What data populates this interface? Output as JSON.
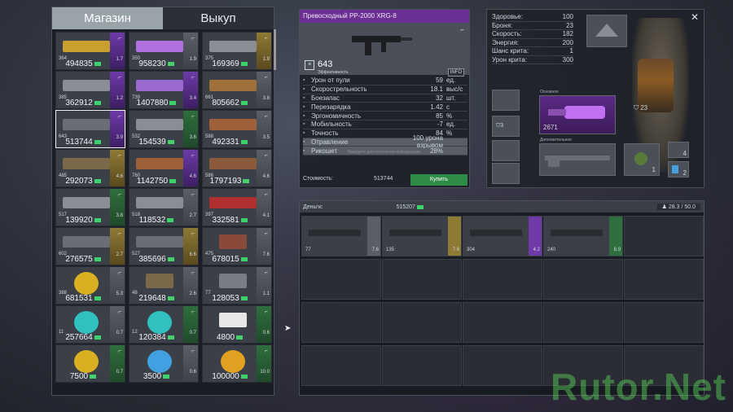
{
  "shop": {
    "tabs": [
      "Магазин",
      "Выкуп"
    ],
    "items": [
      {
        "price": "494835",
        "level": "364",
        "rating": "1.7",
        "tier": "purple",
        "color": "#c9a030",
        "kind": "gun"
      },
      {
        "price": "958230",
        "level": "350",
        "rating": "1.9",
        "tier": "gray",
        "color": "#b070e0",
        "kind": "gun"
      },
      {
        "price": "169369",
        "level": "375",
        "rating": "1.9",
        "tier": "gold",
        "color": "#8a8e94",
        "kind": "gun"
      },
      {
        "price": "362912",
        "level": "385",
        "rating": "1.2",
        "tier": "purple",
        "color": "#8a8e94",
        "kind": "gun"
      },
      {
        "price": "1407880",
        "level": "739",
        "rating": "3.4",
        "tier": "purple",
        "color": "#9a6ad0",
        "kind": "gun"
      },
      {
        "price": "805662",
        "level": "661",
        "rating": "3.8",
        "tier": "gray",
        "color": "#a0703a",
        "kind": "gun"
      },
      {
        "price": "513744",
        "level": "643",
        "rating": "3.9",
        "tier": "purple",
        "color": "#6a6e74",
        "kind": "gun",
        "selected": true
      },
      {
        "price": "154539",
        "level": "532",
        "rating": "3.6",
        "tier": "green",
        "color": "#8a8e94",
        "kind": "gun"
      },
      {
        "price": "492331",
        "level": "588",
        "rating": "3.5",
        "tier": "gray",
        "color": "#a0603a",
        "kind": "gun"
      },
      {
        "price": "292073",
        "level": "485",
        "rating": "4.6",
        "tier": "gold",
        "color": "#7a6a4a",
        "kind": "gun"
      },
      {
        "price": "1142750",
        "level": "760",
        "rating": "4.6",
        "tier": "purple",
        "color": "#a0603a",
        "kind": "gun"
      },
      {
        "price": "1797193",
        "level": "586",
        "rating": "4.6",
        "tier": "gray",
        "color": "#8a5a3a",
        "kind": "gun"
      },
      {
        "price": "139920",
        "level": "517",
        "rating": "3.8",
        "tier": "green",
        "color": "#8a8e94",
        "kind": "gun"
      },
      {
        "price": "118532",
        "level": "518",
        "rating": "2.7",
        "tier": "gray",
        "color": "#8a8e94",
        "kind": "gun"
      },
      {
        "price": "332581",
        "level": "397",
        "rating": "4.1",
        "tier": "gray",
        "color": "#b03030",
        "kind": "gun"
      },
      {
        "price": "276575",
        "level": "602",
        "rating": "2.7",
        "tier": "gold",
        "color": "#6a6e74",
        "kind": "gun"
      },
      {
        "price": "385696",
        "level": "527",
        "rating": "6.6",
        "tier": "gold",
        "color": "#6a6e74",
        "kind": "gun"
      },
      {
        "price": "678015",
        "level": "475",
        "rating": "7.6",
        "tier": "gray",
        "color": "#8a4a3a",
        "kind": "armor"
      },
      {
        "price": "681531",
        "level": "388",
        "rating": "5.3",
        "tier": "gray",
        "color": "#d8b020",
        "kind": "round"
      },
      {
        "price": "219648",
        "level": "48",
        "rating": "2.6",
        "tier": "gray",
        "color": "#7a6a4a",
        "kind": "armor"
      },
      {
        "price": "128053",
        "level": "77",
        "rating": "1.1",
        "tier": "gray",
        "color": "#7a7e84",
        "kind": "armor"
      },
      {
        "price": "257664",
        "level": "11",
        "rating": "0.7",
        "tier": "gray",
        "color": "#30c0c0",
        "kind": "round"
      },
      {
        "price": "120384",
        "level": "12",
        "rating": "0.7",
        "tier": "green",
        "color": "#30c0c0",
        "kind": "round"
      },
      {
        "price": "4800",
        "level": "",
        "rating": "0.6",
        "tier": "green",
        "color": "#e8e8e8",
        "kind": "kit"
      },
      {
        "price": "7500",
        "level": "",
        "rating": "0.7",
        "tier": "green",
        "color": "#d8b020",
        "kind": "round"
      },
      {
        "price": "3500",
        "level": "",
        "rating": "0.6",
        "tier": "gray",
        "color": "#40a0e0",
        "kind": "round"
      },
      {
        "price": "100000",
        "level": "",
        "rating": "10.0",
        "tier": "green",
        "color": "#e0a020",
        "kind": "round"
      }
    ]
  },
  "detail": {
    "title": "Превосходный PP-2000 XRG-8",
    "score": "643",
    "score_label": "Эффективность",
    "info": "INFO",
    "stats": [
      {
        "name": "Урон от пули",
        "value": "59",
        "unit": "ед."
      },
      {
        "name": "Скорострельность",
        "value": "18.1",
        "unit": "выс/с"
      },
      {
        "name": "Боезапас",
        "value": "32",
        "unit": "шт."
      },
      {
        "name": "Перезарядка",
        "value": "1.42",
        "unit": "с"
      },
      {
        "name": "Эргономичность",
        "value": "85",
        "unit": "%"
      },
      {
        "name": "Мобильность",
        "value": "-7",
        "unit": "ед."
      },
      {
        "name": "Точность",
        "value": "84",
        "unit": "%"
      },
      {
        "name": "Отравление",
        "value": "100 урона взрывом",
        "unit": ""
      },
      {
        "name": "Рикошет",
        "value": "28%",
        "unit": ""
      }
    ],
    "hint": "Наведите для получения информации.",
    "cost_label": "Стоимость:",
    "cost_value": "513744",
    "buy_label": "Купить"
  },
  "character": {
    "stats": [
      {
        "k": "Здоровье:",
        "v": "100"
      },
      {
        "k": "Броня:",
        "v": "23"
      },
      {
        "k": "Скорость:",
        "v": "182"
      },
      {
        "k": "Энергия:",
        "v": "200"
      },
      {
        "k": "Шанс крита:",
        "v": "1"
      },
      {
        "k": "Урон крита:",
        "v": "300"
      }
    ],
    "primary_label": "Основное",
    "primary_value": "2671",
    "secondary_label": "Дополнительное",
    "armor_value": "23",
    "slot_value": "3",
    "grenade_count": "1",
    "item2_count": "4",
    "item3_count": "2"
  },
  "inventory": {
    "money_label": "Деньги:",
    "money_value": "515207",
    "weight": "28.3 / 50.0",
    "items": [
      {
        "level": "77",
        "rating": "7.6",
        "tier": "gray"
      },
      {
        "level": "135",
        "rating": "7.6",
        "tier": "gold"
      },
      {
        "level": "304",
        "rating": "4.2",
        "tier": "purple"
      },
      {
        "level": "240",
        "rating": "8.9",
        "tier": "green"
      }
    ]
  },
  "watermark": "Rutor.Net"
}
